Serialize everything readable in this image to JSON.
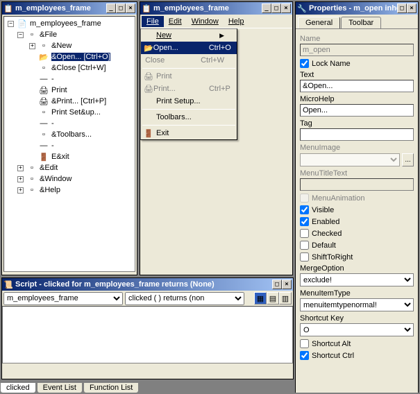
{
  "win1": {
    "title": "m_employees_frame",
    "tree": {
      "root": "m_employees_frame",
      "file": "&File",
      "new": "&New",
      "open": "&Open...  [Ctrl+O]",
      "close": "&Close  [Ctrl+W]",
      "sep1": "-",
      "print": "Print",
      "printm": "&Print...  [Ctrl+P]",
      "printsetup": "Print Set&up...",
      "sep2": "-",
      "toolbars": "&Toolbars...",
      "sep3": "-",
      "exit": "E&xit",
      "edit": "&Edit",
      "window": "&Window",
      "help": "&Help"
    }
  },
  "win2": {
    "title": "m_employees_frame",
    "menu": {
      "file": "File",
      "edit": "Edit",
      "window": "Window",
      "help": "Help"
    },
    "dd": {
      "new": "New",
      "open": "Open...",
      "close": "Close",
      "print": "Print",
      "printm": "Print...",
      "printsetup": "Print Setup...",
      "toolbars": "Toolbars...",
      "exit": "Exit",
      "scOpen": "Ctrl+O",
      "scClose": "Ctrl+W",
      "scPrint": "Ctrl+P"
    }
  },
  "script": {
    "title": "Script - clicked for m_employees_frame returns (None)",
    "sel1": "m_employees_frame",
    "sel2": "clicked ( ) returns (non",
    "tabs": {
      "clicked": "clicked",
      "eventlist": "Event List",
      "funclist": "Function List"
    }
  },
  "props": {
    "title": "Properties - m_open inhe",
    "tabs": {
      "general": "General",
      "toolbar": "Toolbar"
    },
    "labels": {
      "name": "Name",
      "lockname": "Lock Name",
      "text": "Text",
      "microhelp": "MicroHelp",
      "tag": "Tag",
      "menuimage": "MenuImage",
      "menutitletext": "MenuTitleText",
      "menuanimation": "MenuAnimation",
      "visible": "Visible",
      "enabled": "Enabled",
      "checked": "Checked",
      "default": "Default",
      "shifttoright": "ShiftToRight",
      "mergeoption": "MergeOption",
      "menuitemtype": "MenuItemType",
      "shortcutkey": "Shortcut Key",
      "shortcutalt": "Shortcut Alt",
      "shortcutctrl": "Shortcut Ctrl"
    },
    "values": {
      "name": "m_open",
      "text": "&Open...",
      "microhelp": "Open...",
      "tag": "",
      "menuimage": "",
      "menutitletext": "",
      "mergeoption": "exclude!",
      "menuitemtype": "menuitemtypenormal!",
      "shortcutkey": "O"
    }
  }
}
